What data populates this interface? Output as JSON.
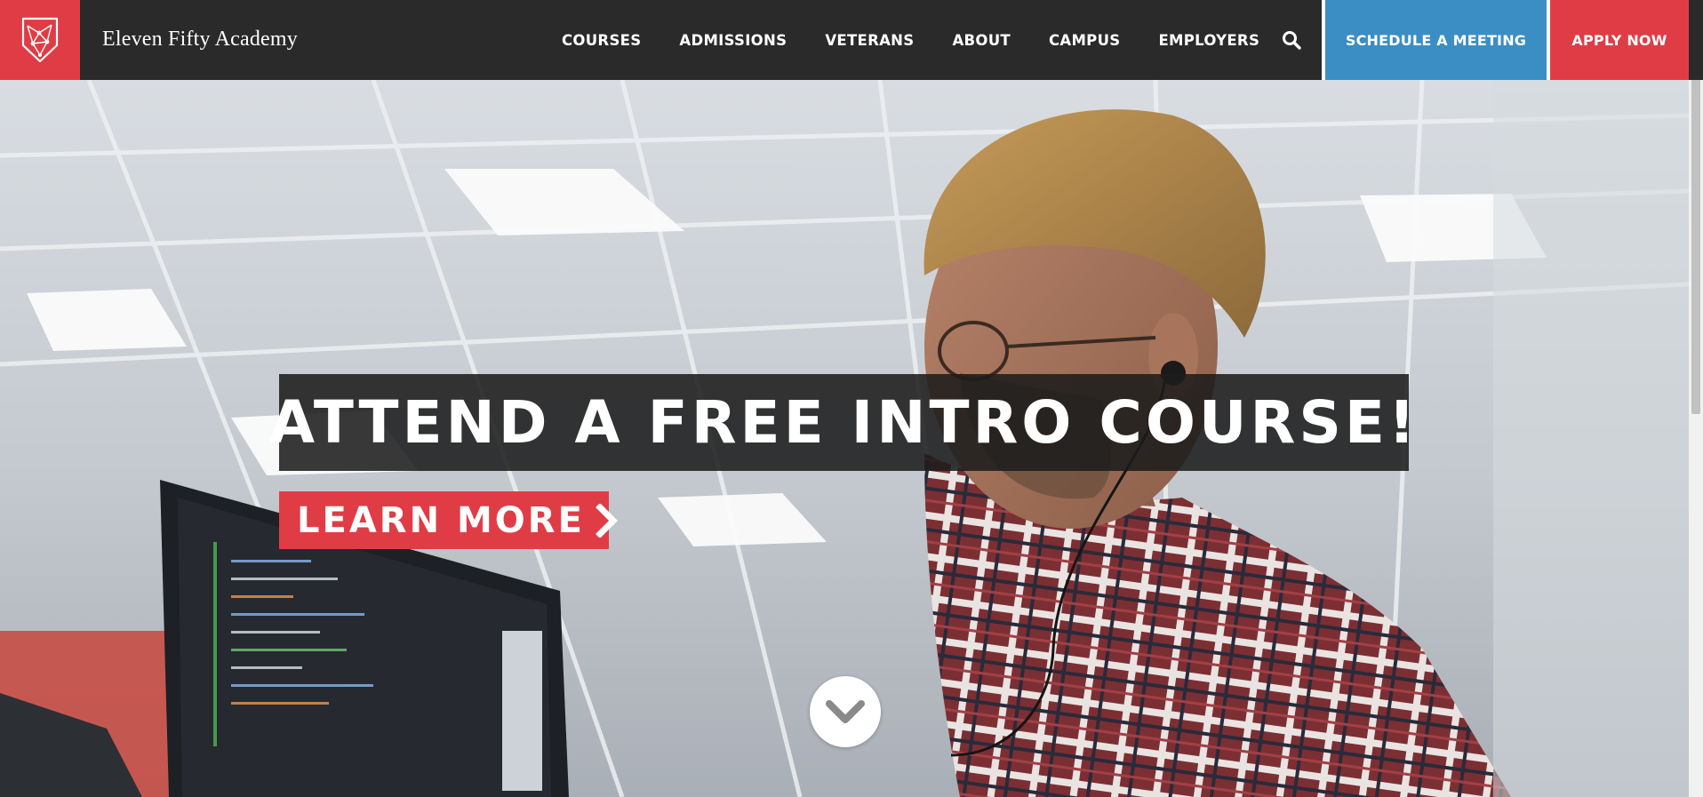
{
  "brand": {
    "name": "Eleven Fifty Academy",
    "logo_icon": "shield-network-icon"
  },
  "nav": {
    "items": [
      {
        "label": "COURSES"
      },
      {
        "label": "ADMISSIONS"
      },
      {
        "label": "VETERANS"
      },
      {
        "label": "ABOUT"
      },
      {
        "label": "CAMPUS"
      },
      {
        "label": "EMPLOYERS"
      }
    ],
    "search_icon": "search-icon"
  },
  "cta": {
    "schedule_label": "SCHEDULE A MEETING",
    "apply_label": "APPLY NOW"
  },
  "hero": {
    "title": "ATTEND A FREE INTRO COURSE!",
    "button_label": "LEARN MORE",
    "button_icon": "chevron-right-icon",
    "scroll_icon": "chevron-down-icon"
  },
  "colors": {
    "header_bg": "#2a2a2a",
    "brand_red": "#e03c45",
    "schedule_blue": "#3b8ec4",
    "title_box": "#1c1c1c"
  }
}
